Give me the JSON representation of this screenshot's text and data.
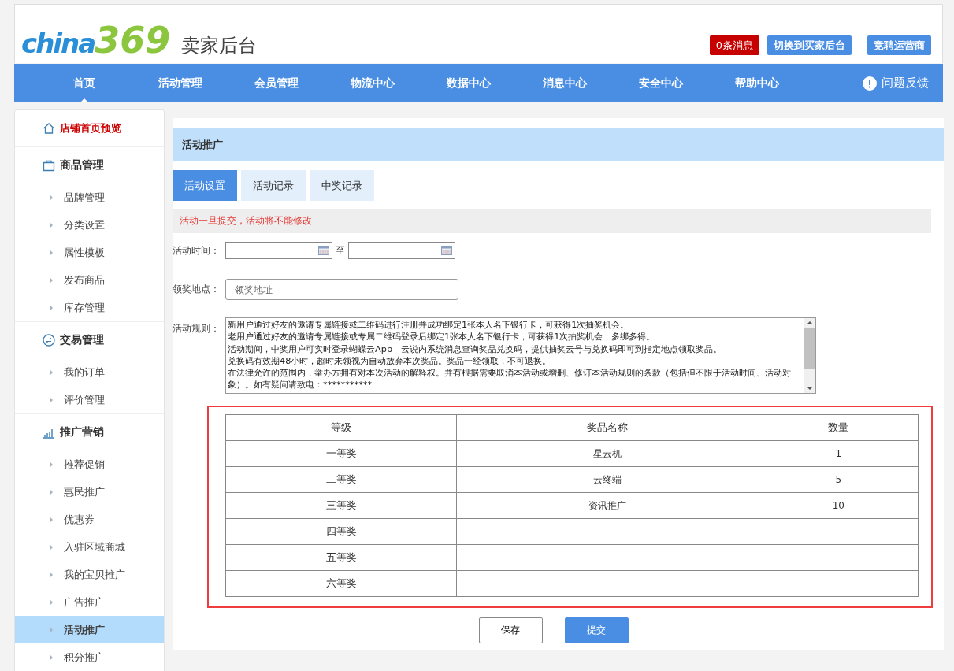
{
  "header": {
    "logo": {
      "word": "china",
      "digits": "369"
    },
    "title": "卖家后台",
    "messages": "0条消息",
    "buttons": [
      "切换到买家后台",
      "竞聘运营商"
    ]
  },
  "nav": {
    "items": [
      {
        "label": "首页",
        "selected": true
      },
      {
        "label": "活动管理",
        "selected": false
      },
      {
        "label": "会员管理",
        "selected": false
      },
      {
        "label": "物流中心",
        "selected": false
      },
      {
        "label": "数据中心",
        "selected": false
      },
      {
        "label": "消息中心",
        "selected": false
      },
      {
        "label": "安全中心",
        "selected": false
      },
      {
        "label": "帮助中心",
        "selected": false
      }
    ],
    "feedback": "问题反馈"
  },
  "sidebar": {
    "preview": "店铺首页预览",
    "groups": [
      {
        "kind": "bag",
        "title": "商品管理",
        "items": [
          {
            "label": "品牌管理",
            "selected": false
          },
          {
            "label": "分类设置",
            "selected": false
          },
          {
            "label": "属性模板",
            "selected": false
          },
          {
            "label": "发布商品",
            "selected": false
          },
          {
            "label": "库存管理",
            "selected": false
          }
        ]
      },
      {
        "kind": "exchange",
        "title": "交易管理",
        "items": [
          {
            "label": "我的订单",
            "selected": false
          },
          {
            "label": "评价管理",
            "selected": false
          }
        ]
      },
      {
        "kind": "chart",
        "title": "推广营销",
        "items": [
          {
            "label": "推荐促销",
            "selected": false
          },
          {
            "label": "惠民推广",
            "selected": false
          },
          {
            "label": "优惠券",
            "selected": false
          },
          {
            "label": "入驻区域商城",
            "selected": false
          },
          {
            "label": "我的宝贝推广",
            "selected": false
          },
          {
            "label": "广告推广",
            "selected": false
          },
          {
            "label": "活动推广",
            "selected": true
          },
          {
            "label": "积分推广",
            "selected": false
          }
        ]
      }
    ]
  },
  "panel": {
    "title": "活动推广",
    "tabs": [
      {
        "label": "活动设置",
        "selected": true
      },
      {
        "label": "活动记录",
        "selected": false
      },
      {
        "label": "中奖记录",
        "selected": false
      }
    ],
    "notice": "活动一旦提交，活动将不能修改",
    "time": {
      "label": "活动时间：",
      "separator": "至"
    },
    "address": {
      "label": "领奖地点：",
      "placeholder": "领奖地址"
    },
    "rules": {
      "label": "活动规则：",
      "lines": [
        "新用户通过好友的邀请专属链接或二维码进行注册并成功绑定1张本人名下银行卡，可获得1次抽奖机会。",
        "老用户通过好友的邀请专属链接或专属二维码登录后绑定1张本人名下银行卡，可获得1次抽奖机会，多绑多得。",
        "活动期间，中奖用户可实时登录蝴蝶云App—云说内系统消息查询奖品兑换码，提供抽奖云号与兑换码即可到指定地点领取奖品。",
        "兑换码有效期48小时，超时未领视为自动放弃本次奖品。奖品一经领取，不可退换。",
        "在法律允许的范围内，举办方拥有对本次活动的解释权。并有根据需要取消本活动或增删、修订本活动规则的条款（包括但不限于活动时间、活动对象）。如有疑问请致电：***********"
      ]
    },
    "table": {
      "columns": [
        "等级",
        "奖品名称",
        "数量"
      ],
      "rows": [
        [
          "一等奖",
          "星云机",
          "1"
        ],
        [
          "二等奖",
          "云终端",
          "5"
        ],
        [
          "三等奖",
          "资讯推广",
          "10"
        ],
        [
          "四等奖",
          "",
          ""
        ],
        [
          "五等奖",
          "",
          ""
        ],
        [
          "六等奖",
          "",
          ""
        ]
      ]
    },
    "buttons": {
      "save": "保存",
      "submit": "提交"
    }
  }
}
